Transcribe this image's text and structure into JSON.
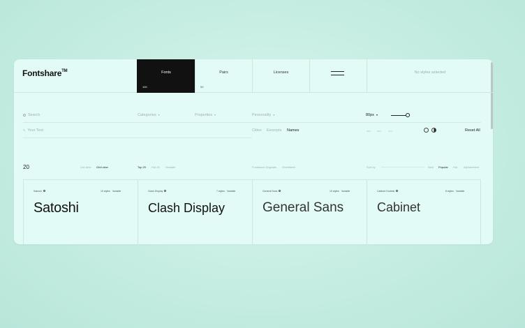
{
  "header": {
    "logo": "Fontshare",
    "logo_tm": "TM",
    "nav": [
      {
        "label": "Fonts",
        "count": "100"
      },
      {
        "label": "Pairs",
        "count": "59"
      },
      {
        "label": "Licenses",
        "count": ""
      }
    ],
    "no_styles": "No styles selected"
  },
  "filters": {
    "search_placeholder": "Search",
    "categories": "Categories",
    "properties": "Properties",
    "personality": "Personality",
    "size_value": "80px",
    "text_placeholder": "Your Text",
    "text_options": [
      "Cities",
      "Excerpts",
      "Names"
    ],
    "swatches": [
      "REC",
      "DEC",
      "CAS"
    ],
    "reset": "Reset All"
  },
  "list": {
    "count": "20",
    "views": [
      "List view",
      "Grid view"
    ],
    "tabs": [
      "Top 20",
      "Hot 20",
      "Variable"
    ],
    "origins": [
      "Fontshare Originals",
      "Shortlisted"
    ],
    "sort_by": "Sort by",
    "sort_options": [
      "New",
      "Popular",
      "Hot",
      "Alphabetical"
    ]
  },
  "cards": [
    {
      "category": "Satoshi",
      "styles": "10 styles",
      "variable": "Variable",
      "name": "Satoshi"
    },
    {
      "category": "Clash Display",
      "styles": "7 styles",
      "variable": "Variable",
      "name": "Clash Display"
    },
    {
      "category": "General Sans",
      "styles": "10 styles",
      "variable": "Variable",
      "name": "General Sans"
    },
    {
      "category": "Cabinet Grotesk",
      "styles": "8 styles",
      "variable": "Variable",
      "name": "Cabinet"
    }
  ]
}
